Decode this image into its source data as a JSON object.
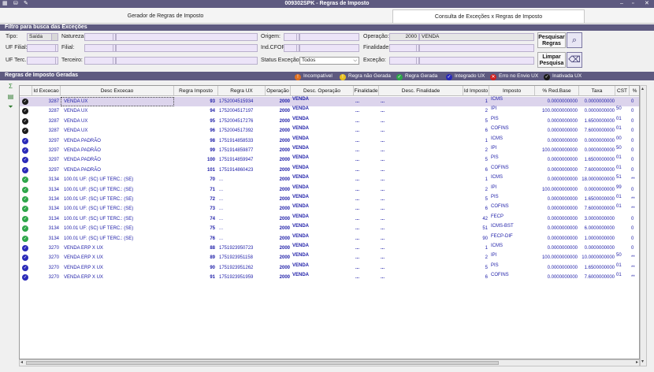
{
  "window": {
    "title": "009302SPK - Regras de Imposto"
  },
  "tabs": [
    {
      "label": "Gerador de Regras de Imposto",
      "active": false
    },
    {
      "label": "Consulta de Exceções x Regras de Imposto",
      "active": true
    }
  ],
  "filter": {
    "header": "Filtro para busca das Exceções",
    "labels": {
      "tipo": "Tipo:",
      "natureza": "Natureza:",
      "origem": "Origem:",
      "operacao": "Operação:",
      "uf_filial": "UF Filial:",
      "filial": "Filial:",
      "ind_cfop": "Ind.CFOP:",
      "finalidade": "Finalidade:",
      "uf_terc": "UF Terc.:",
      "terceiro": "Terceiro:",
      "status_excecao": "Status Exceção:",
      "excecao": "Exceção:"
    },
    "values": {
      "tipo": "Saída",
      "operacao_code": "2000",
      "operacao_desc": "VENDA",
      "status_excecao": "Todos"
    },
    "buttons": {
      "pesquisar": "Pesquisar Regras",
      "limpar": "Limpar Pesquisa"
    }
  },
  "grid_section": {
    "header": "Regras de Imposto Geradas"
  },
  "legend": [
    {
      "label": "Incompatível",
      "color": "#e07020",
      "glyph": "!"
    },
    {
      "label": "Regra não Gerada",
      "color": "#e8c020",
      "glyph": "!"
    },
    {
      "label": "Regra Gerada",
      "color": "#2ea64a",
      "glyph": "✓"
    },
    {
      "label": "Integrado UX",
      "color": "#2a2ab8",
      "glyph": "✓"
    },
    {
      "label": "Erro no Envio UX",
      "color": "#d02020",
      "glyph": "✕"
    },
    {
      "label": "Inativada UX",
      "color": "#1b1b1b",
      "glyph": "✓"
    }
  ],
  "colors": {
    "header_bg": "#5e5a80",
    "field_bg": "#ece4f8",
    "text_blue": "#1e1ea8"
  },
  "columns": [
    "Id Excecao",
    "Desc Excecao",
    "Regra Imposto",
    "Regra UX",
    "Operação",
    "Desc. Operação",
    "Finalidade",
    "Desc. Finalidade",
    "Id Imposto",
    "Imposto",
    "% Red.Base",
    "Taxa",
    "CST",
    "%"
  ],
  "rows": [
    {
      "status": "blk",
      "id": "3287",
      "desc": "VENDA UX",
      "regra": "93",
      "ux": "1752004515934",
      "op": "2000",
      "dop": "VENDA",
      "fin": "...",
      "dfin": "...",
      "idimp": "1",
      "imp": "ICMS",
      "red": "0.0000000000",
      "taxa": "0.0000000000",
      "cst": "",
      "pct": "0"
    },
    {
      "status": "blk",
      "id": "3287",
      "desc": "VENDA UX",
      "regra": "94",
      "ux": "1752004517197",
      "op": "2000",
      "dop": "VENDA",
      "fin": "...",
      "dfin": "...",
      "idimp": "2",
      "imp": "IPI",
      "red": "100.0000000000",
      "taxa": "0.0000000000",
      "cst": "50",
      "pct": "0"
    },
    {
      "status": "blk",
      "id": "3287",
      "desc": "VENDA UX",
      "regra": "95",
      "ux": "1752004517276",
      "op": "2000",
      "dop": "VENDA",
      "fin": "...",
      "dfin": "...",
      "idimp": "5",
      "imp": "PIS",
      "red": "0.0000000000",
      "taxa": "1.6500000000",
      "cst": "01",
      "pct": "0"
    },
    {
      "status": "blk",
      "id": "3287",
      "desc": "VENDA UX",
      "regra": "96",
      "ux": "1752004517392",
      "op": "2000",
      "dop": "VENDA",
      "fin": "...",
      "dfin": "...",
      "idimp": "6",
      "imp": "COFINS",
      "red": "0.0000000000",
      "taxa": "7.6000000000",
      "cst": "01",
      "pct": "0"
    },
    {
      "status": "blu",
      "id": "3297",
      "desc": "VENDA PADRÃO",
      "regra": "98",
      "ux": "1751914858533",
      "op": "2000",
      "dop": "VENDA",
      "fin": "...",
      "dfin": "...",
      "idimp": "1",
      "imp": "ICMS",
      "red": "0.0000000000",
      "taxa": "0.0000000000",
      "cst": "00",
      "pct": "0"
    },
    {
      "status": "blu",
      "id": "3297",
      "desc": "VENDA PADRÃO",
      "regra": "99",
      "ux": "1751914859877",
      "op": "2000",
      "dop": "VENDA",
      "fin": "...",
      "dfin": "...",
      "idimp": "2",
      "imp": "IPI",
      "red": "100.0000000000",
      "taxa": "0.0000000000",
      "cst": "50",
      "pct": "0"
    },
    {
      "status": "blu",
      "id": "3297",
      "desc": "VENDA PADRÃO",
      "regra": "100",
      "ux": "1751914859947",
      "op": "2000",
      "dop": "VENDA",
      "fin": "...",
      "dfin": "...",
      "idimp": "5",
      "imp": "PIS",
      "red": "0.0000000000",
      "taxa": "1.6500000000",
      "cst": "01",
      "pct": "0"
    },
    {
      "status": "blu",
      "id": "3297",
      "desc": "VENDA PADRÃO",
      "regra": "101",
      "ux": "1751914860423",
      "op": "2000",
      "dop": "VENDA",
      "fin": "...",
      "dfin": "...",
      "idimp": "6",
      "imp": "COFINS",
      "red": "0.0000000000",
      "taxa": "7.6000000000",
      "cst": "01",
      "pct": "0"
    },
    {
      "status": "grn",
      "id": "3134",
      "desc": "100.01 UF: (SC) UF TERC.: (SE)",
      "regra": "70",
      "ux": "...",
      "op": "2000",
      "dop": "VENDA",
      "fin": "...",
      "dfin": "...",
      "idimp": "1",
      "imp": "ICMS",
      "red": "0.0000000000",
      "taxa": "18.0000000000",
      "cst": "51",
      "pct": "**"
    },
    {
      "status": "grn",
      "id": "3134",
      "desc": "100.01 UF: (SC) UF TERC.: (SE)",
      "regra": "71",
      "ux": "...",
      "op": "2000",
      "dop": "VENDA",
      "fin": "...",
      "dfin": "...",
      "idimp": "2",
      "imp": "IPI",
      "red": "100.0000000000",
      "taxa": "0.0000000000",
      "cst": "99",
      "pct": "0"
    },
    {
      "status": "grn",
      "id": "3134",
      "desc": "100.01 UF: (SC) UF TERC.: (SE)",
      "regra": "72",
      "ux": "...",
      "op": "2000",
      "dop": "VENDA",
      "fin": "...",
      "dfin": "...",
      "idimp": "5",
      "imp": "PIS",
      "red": "0.0000000000",
      "taxa": "1.6500000000",
      "cst": "01",
      "pct": "**"
    },
    {
      "status": "grn",
      "id": "3134",
      "desc": "100.01 UF: (SC) UF TERC.: (SE)",
      "regra": "73",
      "ux": "...",
      "op": "2000",
      "dop": "VENDA",
      "fin": "...",
      "dfin": "...",
      "idimp": "6",
      "imp": "COFINS",
      "red": "0.0000000000",
      "taxa": "7.6000000000",
      "cst": "01",
      "pct": "**"
    },
    {
      "status": "grn",
      "id": "3134",
      "desc": "100.01 UF: (SC) UF TERC.: (SE)",
      "regra": "74",
      "ux": "...",
      "op": "2000",
      "dop": "VENDA",
      "fin": "...",
      "dfin": "...",
      "idimp": "42",
      "imp": "FECP",
      "red": "0.0000000000",
      "taxa": "3.0000000000",
      "cst": "",
      "pct": "0"
    },
    {
      "status": "grn",
      "id": "3134",
      "desc": "100.01 UF: (SC) UF TERC.: (SE)",
      "regra": "75",
      "ux": "...",
      "op": "2000",
      "dop": "VENDA",
      "fin": "...",
      "dfin": "...",
      "idimp": "51",
      "imp": "ICMS-BST",
      "red": "0.0000000000",
      "taxa": "6.0000000000",
      "cst": "",
      "pct": "0"
    },
    {
      "status": "grn",
      "id": "3134",
      "desc": "100.01 UF: (SC) UF TERC.: (SE)",
      "regra": "76",
      "ux": "...",
      "op": "2000",
      "dop": "VENDA",
      "fin": "...",
      "dfin": "...",
      "idimp": "90",
      "imp": "FECP-DIF",
      "red": "0.0000000000",
      "taxa": "1.0000000000",
      "cst": "",
      "pct": "0"
    },
    {
      "status": "blu",
      "id": "3270",
      "desc": "VENDA ERP X UX",
      "regra": "88",
      "ux": "1751923950723",
      "op": "2000",
      "dop": "VENDA",
      "fin": "...",
      "dfin": "...",
      "idimp": "1",
      "imp": "ICMS",
      "red": "0.0000000000",
      "taxa": "0.0000000000",
      "cst": "",
      "pct": "0"
    },
    {
      "status": "blu",
      "id": "3270",
      "desc": "VENDA ERP X UX",
      "regra": "89",
      "ux": "1751923951158",
      "op": "2000",
      "dop": "VENDA",
      "fin": "...",
      "dfin": "...",
      "idimp": "2",
      "imp": "IPI",
      "red": "100.0000000000",
      "taxa": "10.0000000000",
      "cst": "50",
      "pct": "**"
    },
    {
      "status": "blu",
      "id": "3270",
      "desc": "VENDA ERP X UX",
      "regra": "90",
      "ux": "1751923951262",
      "op": "2000",
      "dop": "VENDA",
      "fin": "...",
      "dfin": "...",
      "idimp": "5",
      "imp": "PIS",
      "red": "0.0000000000",
      "taxa": "1.6500000000",
      "cst": "01",
      "pct": "**"
    },
    {
      "status": "blu",
      "id": "3270",
      "desc": "VENDA ERP X UX",
      "regra": "91",
      "ux": "1751923951959",
      "op": "2000",
      "dop": "VENDA",
      "fin": "...",
      "dfin": "...",
      "idimp": "6",
      "imp": "COFINS",
      "red": "0.0000000000",
      "taxa": "7.6000000000",
      "cst": "01",
      "pct": "**"
    }
  ]
}
